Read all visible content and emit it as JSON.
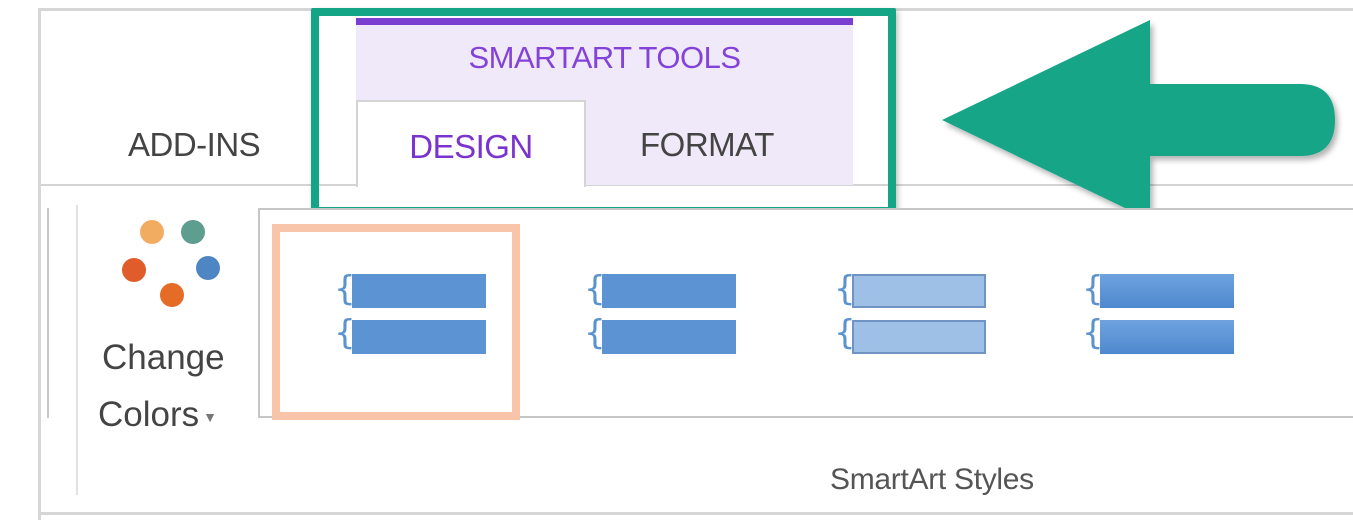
{
  "tabs": {
    "add_ins": "ADD-INS",
    "design": "DESIGN",
    "format": "FORMAT"
  },
  "contextual_group": {
    "title": "SMARTART TOOLS",
    "accent_color": "#7a3fd0",
    "background_color": "#efe9f9"
  },
  "highlight": {
    "color": "#13a586",
    "arrow_icon": "arrow-left-icon"
  },
  "ribbon": {
    "change_colors": {
      "line1": "Change",
      "line2": "Colors",
      "dropdown_icon": "caret-down-icon",
      "dot_colors": [
        "#f2ac62",
        "#5e9e8e",
        "#e05d2b",
        "#4e86c4",
        "#e46c26"
      ]
    },
    "gallery": {
      "group_label": "SmartArt Styles",
      "selected_index": 0,
      "selection_color": "#f8c5aa",
      "items": [
        {
          "name": "simple-fill",
          "fill": "#5b93d3"
        },
        {
          "name": "white-outline",
          "fill": "#5b93d3"
        },
        {
          "name": "subtle-effect",
          "fill": "#9ebfe6"
        },
        {
          "name": "moderate-effect",
          "fill": "#4f88cf"
        }
      ]
    }
  }
}
